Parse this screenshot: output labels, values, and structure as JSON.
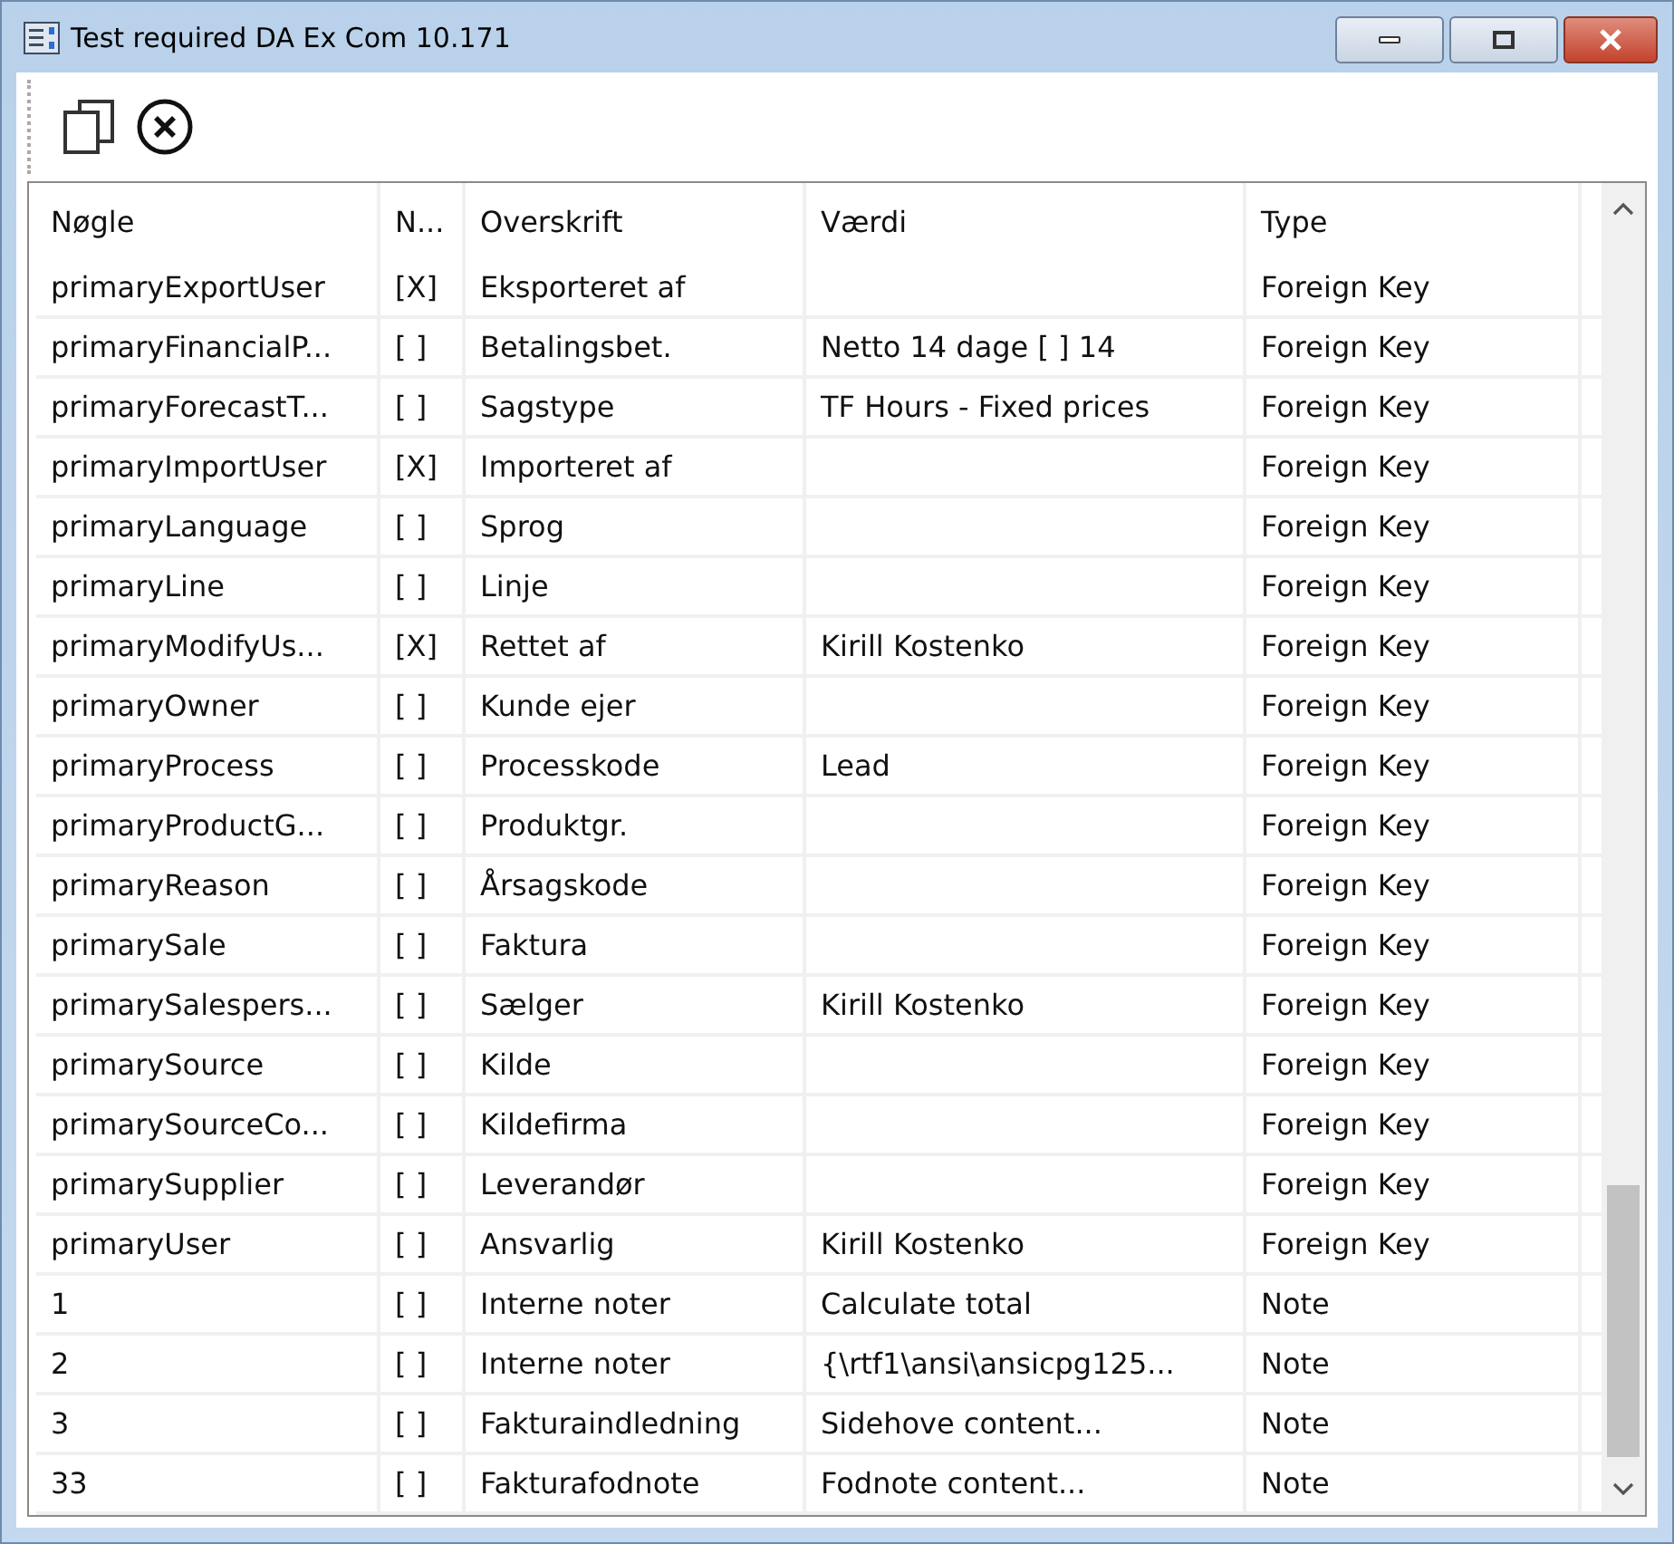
{
  "window": {
    "title": "Test required DA Ex Com 10.171"
  },
  "toolbar": {
    "buttons": [
      {
        "kind": "copy"
      },
      {
        "kind": "cancel"
      }
    ]
  },
  "table": {
    "columns": [
      "Nøgle",
      "N...",
      "Overskrift",
      "Værdi",
      "Type"
    ],
    "rows": [
      [
        "primaryExportUser",
        "[X]",
        "Eksporteret af",
        "",
        "Foreign Key"
      ],
      [
        "primaryFinancialP...",
        "[ ]",
        "Betalingsbet.",
        "Netto 14 dage [ ] 14",
        "Foreign Key"
      ],
      [
        "primaryForecastT...",
        "[ ]",
        "Sagstype",
        "TF Hours - Fixed prices",
        "Foreign Key"
      ],
      [
        "primaryImportUser",
        "[X]",
        "Importeret af",
        "",
        "Foreign Key"
      ],
      [
        "primaryLanguage",
        "[ ]",
        "Sprog",
        "",
        "Foreign Key"
      ],
      [
        "primaryLine",
        "[ ]",
        "Linje",
        "",
        "Foreign Key"
      ],
      [
        "primaryModifyUs...",
        "[X]",
        "Rettet af",
        "Kirill Kostenko",
        "Foreign Key"
      ],
      [
        "primaryOwner",
        "[ ]",
        "Kunde ejer",
        "",
        "Foreign Key"
      ],
      [
        "primaryProcess",
        "[ ]",
        "Processkode",
        "Lead",
        "Foreign Key"
      ],
      [
        "primaryProductG...",
        "[ ]",
        "Produktgr.",
        "",
        "Foreign Key"
      ],
      [
        "primaryReason",
        "[ ]",
        "Årsagskode",
        "",
        "Foreign Key"
      ],
      [
        "primarySale",
        "[ ]",
        "Faktura",
        "",
        "Foreign Key"
      ],
      [
        "primarySalespers...",
        "[ ]",
        "Sælger",
        "Kirill Kostenko",
        "Foreign Key"
      ],
      [
        "primarySource",
        "[ ]",
        "Kilde",
        "",
        "Foreign Key"
      ],
      [
        "primarySourceCo...",
        "[ ]",
        "Kildefirma",
        "",
        "Foreign Key"
      ],
      [
        "primarySupplier",
        "[ ]",
        "Leverandør",
        "",
        "Foreign Key"
      ],
      [
        "primaryUser",
        "[ ]",
        "Ansvarlig",
        "Kirill Kostenko",
        "Foreign Key"
      ],
      [
        "1",
        "[ ]",
        "Interne noter",
        "Calculate total",
        "Note"
      ],
      [
        "2",
        "[ ]",
        "Interne noter",
        "{\\rtf1\\ansi\\ansicpg125...",
        "Note"
      ],
      [
        "3",
        "[ ]",
        "Fakturaindledning",
        "Sidehove content...",
        "Note"
      ],
      [
        "33",
        "[ ]",
        "Fakturafodnote",
        "Fodnote content...",
        "Note"
      ]
    ]
  }
}
